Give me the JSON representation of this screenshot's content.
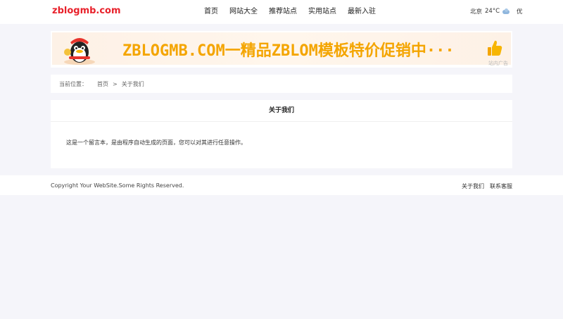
{
  "header": {
    "logo": "zblogmb.com",
    "nav": [
      "首页",
      "网站大全",
      "推荐站点",
      "实用站点",
      "最新入驻"
    ],
    "weather": {
      "city": "北京",
      "temperature": "24°C",
      "condition_icon": "cloud-icon",
      "aqi": "优"
    }
  },
  "banner": {
    "text": "ZBLOGMB.COM一精品ZBLOM模板特价促销中···",
    "ad_label": "站内广告"
  },
  "breadcrumb": {
    "label": "当前位置：",
    "home": "首页",
    "separator": ">",
    "current": "关于我们"
  },
  "content": {
    "title": "关于我们",
    "body": "这是一个留言本，是由程序自动生成的页面，您可以对其进行任意操作。"
  },
  "footer": {
    "copyright": "Copyright Your WebSite.Some Rights Reserved.",
    "links": [
      "关于我们",
      "联系客服"
    ]
  },
  "colors": {
    "logo": "#e8212b",
    "banner_text": "#f4a500",
    "page_bg": "#f5f5fa"
  }
}
